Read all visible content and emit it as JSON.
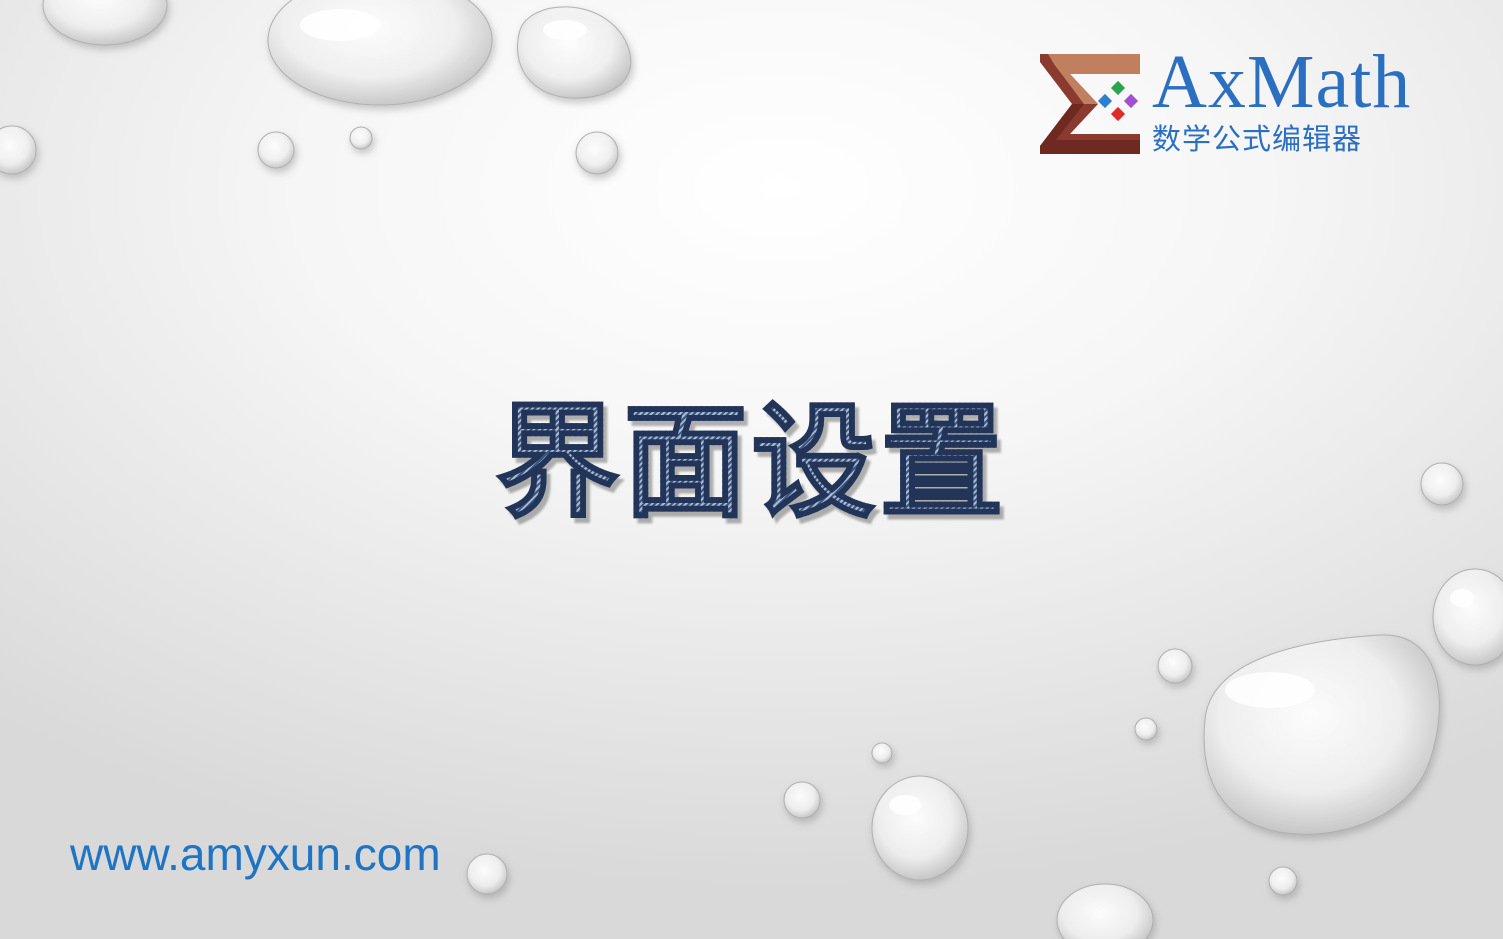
{
  "logo": {
    "name": "AxMath",
    "tagline": "数学公式编辑器",
    "colors": {
      "sigma_dark": "#8a3a2e",
      "sigma_light": "#c08060",
      "text": "#2a6fc0",
      "diamond_blue": "#2f7fd0",
      "diamond_green": "#2da44e",
      "diamond_purple": "#a24fd0",
      "diamond_red": "#e02a2a"
    }
  },
  "slide": {
    "title": "界面设置",
    "title_color": "#3d5681"
  },
  "footer": {
    "website": "www.amyxun.com",
    "website_color": "#1f74c4"
  },
  "background": {
    "style": "light gray gradient with water droplets"
  }
}
